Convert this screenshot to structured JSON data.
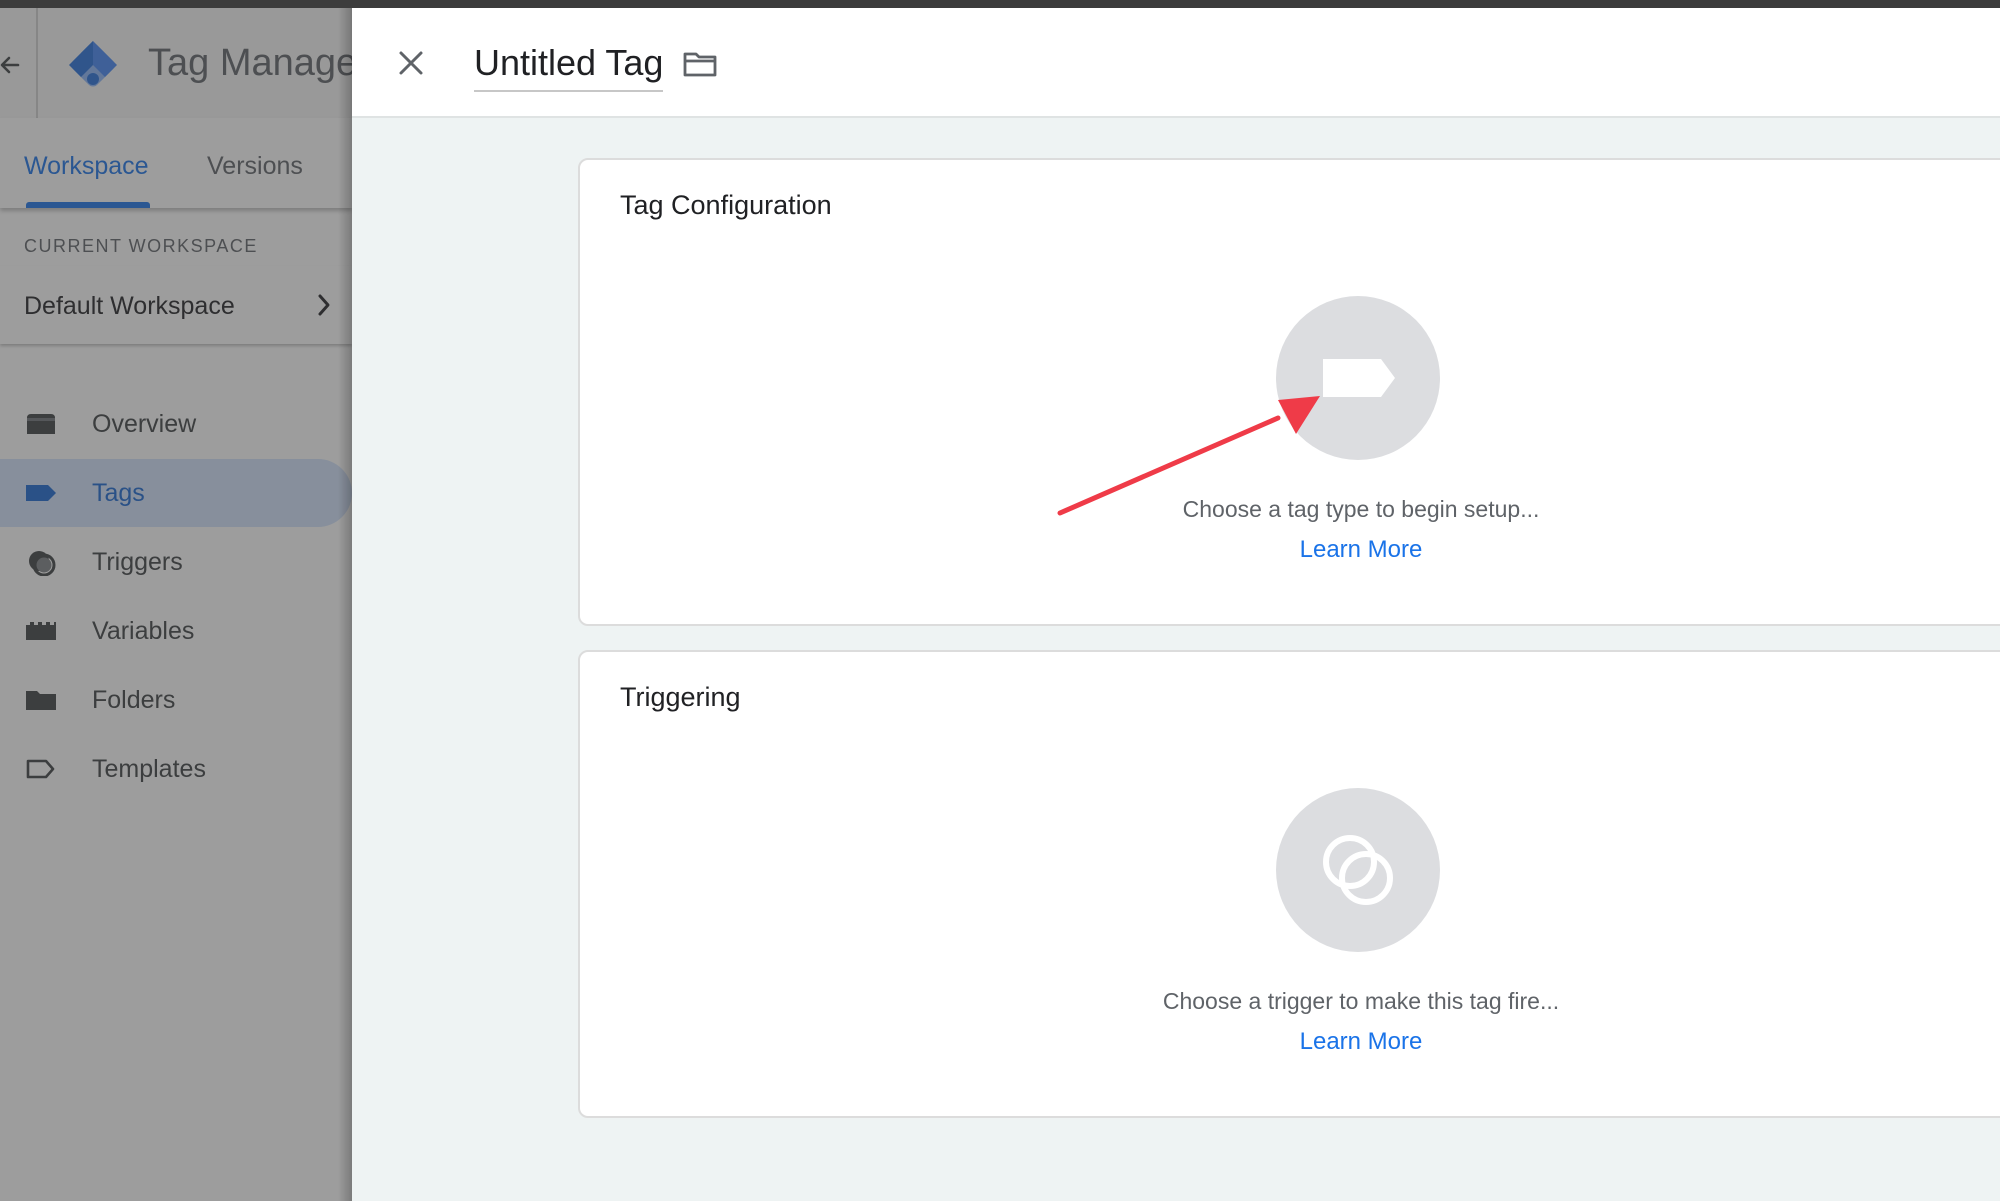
{
  "sidebar": {
    "app_name": "Tag Manager",
    "back_icon": "arrow-left-icon",
    "logo_icon": "gtm-logo-icon",
    "tabs": [
      {
        "label": "Workspace",
        "active": true
      },
      {
        "label": "Versions",
        "active": false
      }
    ],
    "current_workspace_label": "CURRENT WORKSPACE",
    "workspace_name": "Default Workspace",
    "nav": [
      {
        "label": "Overview",
        "icon": "overview-icon",
        "active": false
      },
      {
        "label": "Tags",
        "icon": "tag-icon",
        "active": true
      },
      {
        "label": "Triggers",
        "icon": "trigger-icon",
        "active": false
      },
      {
        "label": "Variables",
        "icon": "variables-icon",
        "active": false
      },
      {
        "label": "Folders",
        "icon": "folder-icon",
        "active": false
      },
      {
        "label": "Templates",
        "icon": "template-icon",
        "active": false
      }
    ]
  },
  "editor": {
    "title": "Untitled Tag",
    "close_icon": "close-icon",
    "folder_icon": "folder-outline-icon",
    "tag_configuration": {
      "title": "Tag Configuration",
      "icon": "tag-type-icon",
      "hint": "Choose a tag type to begin setup...",
      "link": "Learn More"
    },
    "triggering": {
      "title": "Triggering",
      "icon": "trigger-circles-icon",
      "hint": "Choose a trigger to make this tag fire...",
      "link": "Learn More"
    }
  },
  "annotation": {
    "type": "arrow",
    "color": "#ef3b48"
  },
  "colors": {
    "accent": "#1a73e8",
    "active_nav_bg": "#d2e3fc",
    "panel_bg": "#eef3f3"
  }
}
